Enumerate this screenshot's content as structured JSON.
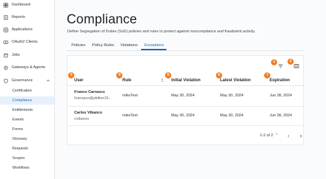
{
  "sidebar": {
    "items": [
      {
        "label": "Dashboard",
        "icon": "dashboard-icon"
      },
      {
        "label": "Reports",
        "icon": "reports-icon"
      },
      {
        "label": "Applications",
        "icon": "applications-icon"
      },
      {
        "label": "OAuth2 Clients",
        "icon": "oauth-icon"
      },
      {
        "label": "Jobs",
        "icon": "jobs-icon"
      },
      {
        "label": "Gateways & Agents",
        "icon": "gateways-icon"
      },
      {
        "label": "Governance",
        "icon": "governance-icon"
      }
    ],
    "sub_items": [
      {
        "label": "Certification"
      },
      {
        "label": "Compliance",
        "active": true
      },
      {
        "label": "Entitlements"
      },
      {
        "label": "Events"
      },
      {
        "label": "Forms"
      },
      {
        "label": "Glossary"
      },
      {
        "label": "Requests"
      },
      {
        "label": "Scopes"
      },
      {
        "label": "Workflows"
      }
    ]
  },
  "page": {
    "title": "Compliance",
    "description": "Define Segregation of Duties (SoD) policies and rules to protect against noncompliance and fraudulent activity."
  },
  "tabs": [
    {
      "label": "Policies"
    },
    {
      "label": "Policy Rules"
    },
    {
      "label": "Violations"
    },
    {
      "label": "Exceptions",
      "active": true
    }
  ],
  "table": {
    "columns": [
      {
        "label": "User",
        "badge": "3"
      },
      {
        "label": "Rule",
        "badge": "4"
      },
      {
        "label": "Initial Violation",
        "badge": "5"
      },
      {
        "label": "Latest Violation",
        "badge": "6"
      },
      {
        "label": "Expiration",
        "badge": "7"
      }
    ],
    "toolbar_badges": [
      "1",
      "2"
    ],
    "rows": [
      {
        "user_name": "Franco Carrasco",
        "user_sub": "fcarrasco@pbilton19...",
        "rule": "mikeTest",
        "initial": "May 30, 2024",
        "latest": "May 30, 2024",
        "expiration": "Jun 28, 2024"
      },
      {
        "user_name": "Carlos Vibanco",
        "user_sub": "cvibanco",
        "rule": "mikeTest",
        "initial": "May 30, 2024",
        "latest": "May 30, 2024",
        "expiration": "Jun 28, 2024"
      }
    ]
  },
  "pagination": {
    "range": "1-2 of 2",
    "dropdown": "⌄",
    "prev": "‹",
    "next": "›"
  },
  "colors": {
    "accent": "#1565c0",
    "badge": "#f07e26",
    "active_bg": "#e7f0fb"
  }
}
